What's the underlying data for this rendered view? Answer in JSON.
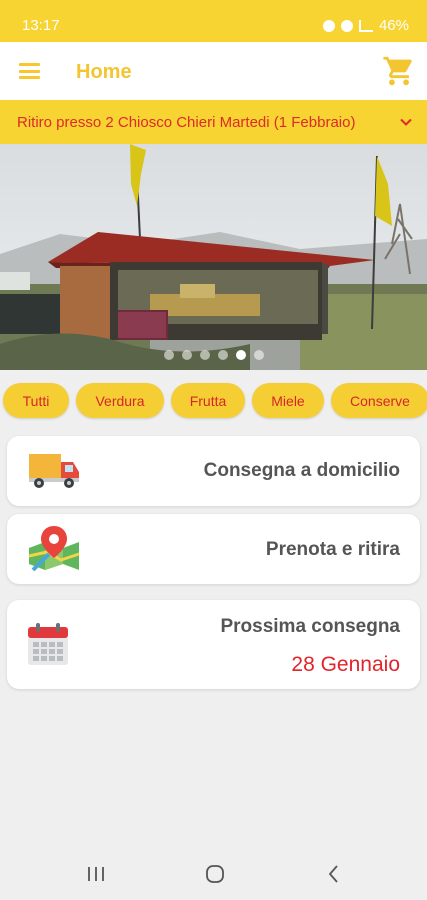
{
  "status_bar": {
    "time": "13:17",
    "battery": "46%"
  },
  "header": {
    "title": "Home",
    "menu_icon": "hamburger-icon",
    "cart_icon": "cart-icon"
  },
  "pickup": {
    "text": "Ritiro presso 2 Chiosco Chieri Martedi (1 Febbraio)"
  },
  "banner": {
    "slides": 6,
    "active_slide": 5
  },
  "categories": [
    "Tutti",
    "Verdura",
    "Frutta",
    "Miele",
    "Conserve"
  ],
  "cards": {
    "delivery": {
      "label": "Consegna a domicilio",
      "icon": "delivery-truck-icon"
    },
    "reserve": {
      "label": "Prenota e ritira",
      "icon": "map-pin-icon"
    },
    "next": {
      "label": "Prossima consegna",
      "date": "28 Gennaio",
      "icon": "calendar-icon"
    }
  },
  "colors": {
    "accent": "#f7d431",
    "text_red": "#dd2a2a",
    "card_text": "#555555"
  }
}
